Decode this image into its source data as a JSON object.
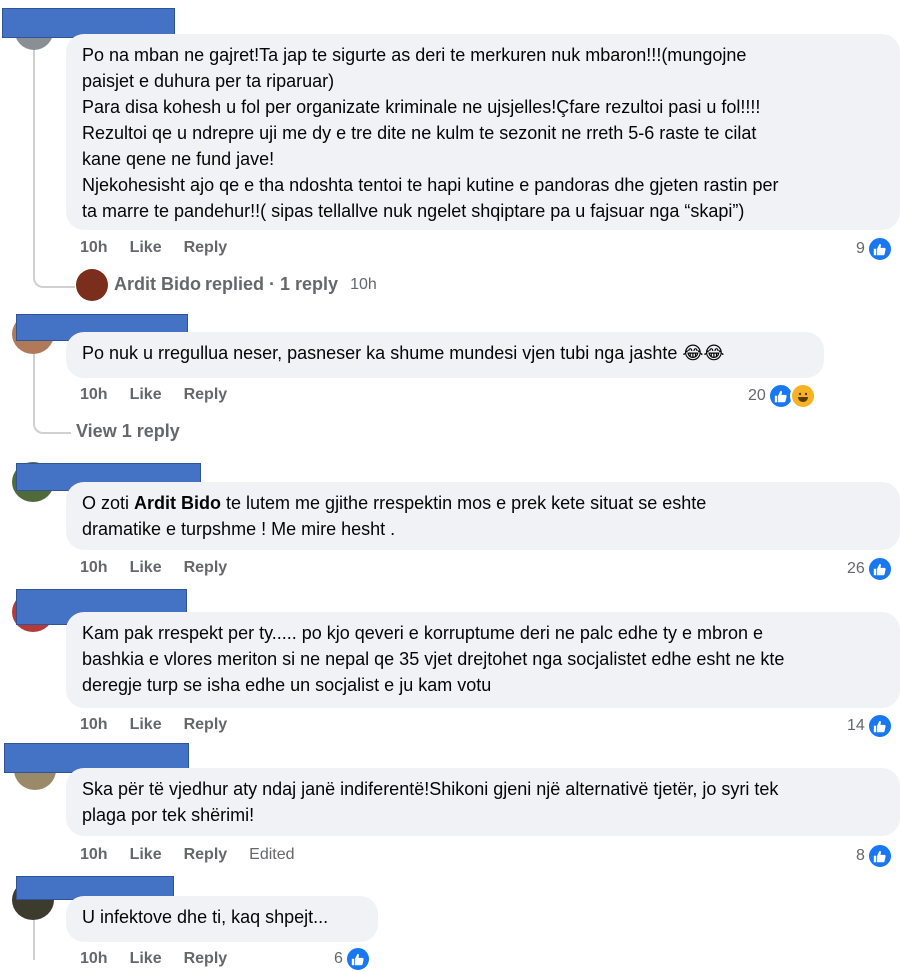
{
  "comments": [
    {
      "lines": [
        "Po na mban ne gajret!Ta jap te sigurte as deri te merkuren nuk mbaron!!!(mungojne",
        "paisjet e duhura per ta riparuar)",
        "Para disa kohesh u fol per organizate kriminale ne ujsjelles!Çfare rezultoi pasi u fol!!!!",
        "Rezultoi qe u ndrepre uji me dy e tre dite ne kulm te sezonit ne rreth 5-6 raste te cilat",
        "kane qene ne fund jave!",
        "Njekohesisht ajo qe e tha ndoshta tentoi te hapi kutine e pandoras dhe gjeten rastin per",
        "ta marre te pandehur!!( sipas tellallve nuk ngelet shqiptare pa u fajsuar nga “skapi”)"
      ],
      "time": "10h",
      "like": "Like",
      "reply": "Reply",
      "count": "9"
    },
    {
      "lines": [
        "Po nuk u rregullua neser, pasneser ka shume mundesi vjen tubi nga jashte 😂😂"
      ],
      "time": "10h",
      "like": "Like",
      "reply": "Reply",
      "count": "20"
    },
    {
      "pre": "O zoti ",
      "mention": "Ardit Bido",
      "post": " te lutem me gjithe rrespektin mos e prek kete situat se eshte",
      "line2": "dramatike e turpshme ! Me mire hesht .",
      "time": "10h",
      "like": "Like",
      "reply": "Reply",
      "count": "26"
    },
    {
      "lines": [
        "Kam pak rrespekt per ty..... po kjo qeveri e korruptume deri ne palc edhe ty e mbron e",
        "bashkia e vlores meriton si ne nepal qe 35 vjet drejtohet nga socjalistet edhe esht ne kte",
        "deregje turp se isha edhe un socjalist e ju kam votu"
      ],
      "time": "10h",
      "like": "Like",
      "reply": "Reply",
      "count": "14"
    },
    {
      "lines": [
        "Ska për të vjedhur aty ndaj janë indiferentë!Shikoni gjeni një alternativë tjetër, jo syri tek",
        "plaga por tek shërimi!"
      ],
      "time": "10h",
      "like": "Like",
      "reply": "Reply",
      "edited": "Edited",
      "count": "8"
    },
    {
      "lines": [
        "U infektove dhe ti, kaq shpejt..."
      ],
      "time": "10h",
      "like": "Like",
      "reply": "Reply",
      "count": "6"
    }
  ],
  "replies_summary": {
    "author": "Ardit Bido",
    "action": "replied · 1 reply",
    "time": "10h"
  },
  "view_reply": "View 1 reply",
  "colors": {
    "accent": "#1877f2",
    "bubble": "#f0f2f5",
    "redaction": "#4472c4"
  },
  "icons": [
    "like-icon",
    "haha-icon",
    "avatar"
  ]
}
